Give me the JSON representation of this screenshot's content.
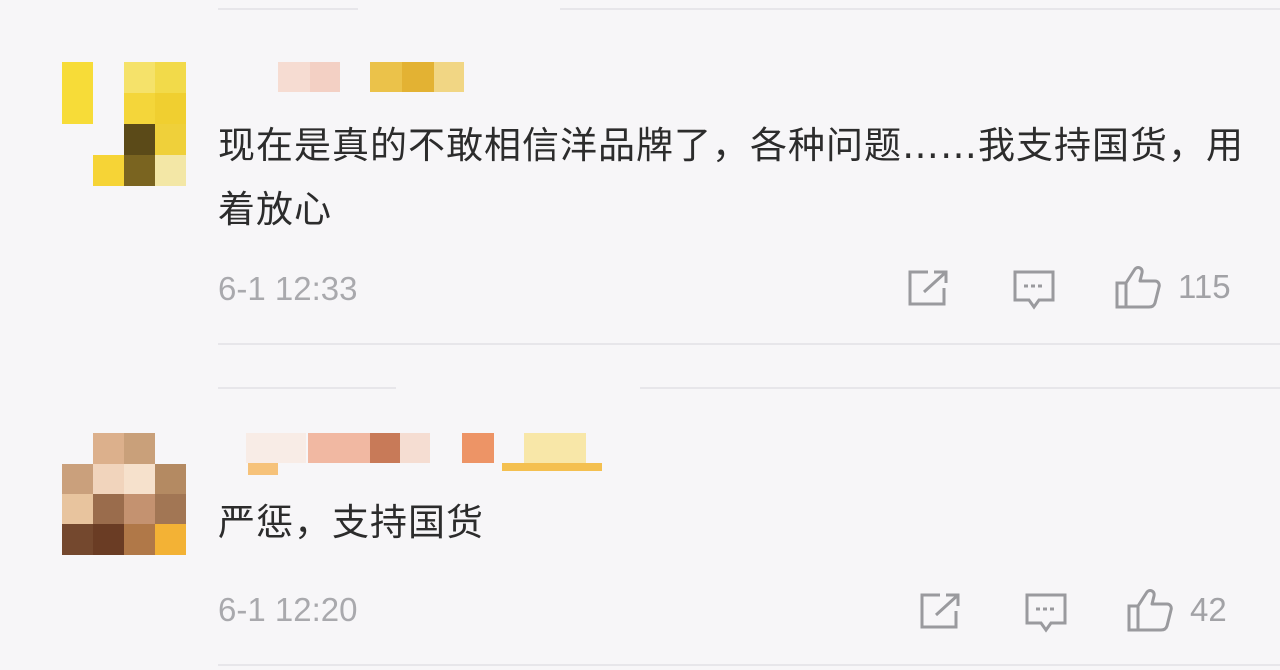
{
  "comments": [
    {
      "text": "现在是真的不敢相信洋品牌了，各种问题……我支持国货，用着放心",
      "time": "6-1 12:33",
      "likes": "115",
      "avatar_colors": [
        "#f5d93a",
        "#e8c42b",
        "#5a4a16",
        "#fbe27a"
      ]
    },
    {
      "text": "严惩，支持国货",
      "time": "6-1 12:20",
      "likes": "42",
      "avatar_colors": [
        "#c89a72",
        "#e7c2a2",
        "#8a5a3a",
        "#f0b94a"
      ]
    }
  ],
  "icons": {
    "share": "share-icon",
    "comment": "comment-icon",
    "like": "thumbs-up-icon"
  }
}
